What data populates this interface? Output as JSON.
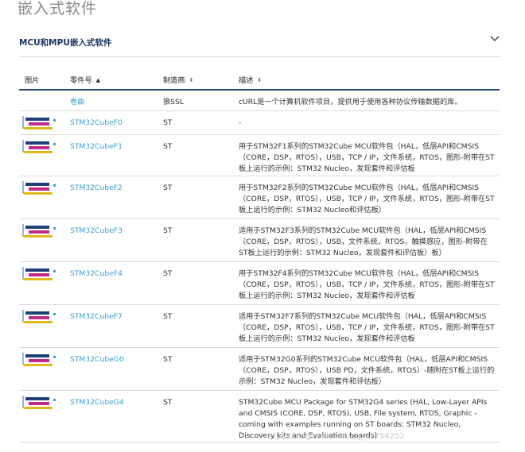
{
  "page": {
    "title": "嵌入式软件"
  },
  "section": {
    "title": "MCU和MPU嵌入式软件"
  },
  "table": {
    "headers": {
      "image": "图片",
      "part": "零件号",
      "manufacturer": "制造商",
      "description": "描述"
    },
    "rows": [
      {
        "has_image": false,
        "name": "卷曲",
        "manufacturer": "狼SSL",
        "description": "cURL是一个计算机软件项目，提供用于使用各种协议传输数据的库。"
      },
      {
        "has_image": true,
        "name": "STM32CubeF0",
        "manufacturer": "ST",
        "description": "-"
      },
      {
        "has_image": true,
        "name": "STM32CubeF1",
        "manufacturer": "ST",
        "description": "用于STM32F1系列的STM32Cube MCU软件包（HAL，低层API和CMSIS（CORE，DSP，RTOS），USB，TCP / IP，文件系统，RTOS，图形-附带在ST板上运行的示例：STM32 Nucleo，发现套件和评估板"
      },
      {
        "has_image": true,
        "name": "STM32CubeF2",
        "manufacturer": "ST",
        "description": "用于STM32F2系列的STM32Cube MCU软件包（HAL，低层API和CMSIS（CORE，DSP，RTOS），USB，TCP / IP，文件系统，RTOS，图形-附带在ST板上运行的示例：STM32 Nucleo和评估板）"
      },
      {
        "has_image": true,
        "name": "STM32CubeF3",
        "manufacturer": "ST",
        "description": "适用于STM32F3系列的STM32Cube MCU软件包（HAL，低层API和CMSIS（CORE，DSP，RTOS），USB，文件系统，RTOS，触摸感应，图形-附带在ST板上运行的示例：STM32 Nucleo，发现套件和评估板）板）"
      },
      {
        "has_image": true,
        "name": "STM32CubeF4",
        "manufacturer": "ST",
        "description": "用于STM32F4系列的STM32Cube MCU软件包（HAL，低层API和CMSIS（CORE，DSP，RTOS），USB，TCP / IP，文件系统，RTOS，图形-附带在ST板上运行的示例：STM32 Nucleo，发现套件和评估板"
      },
      {
        "has_image": true,
        "name": "STM32CubeF7",
        "manufacturer": "ST",
        "description": "适用于STM32F7系列的STM32Cube MCU软件包（HAL，低层API和CMSIS（CORE，DSP，RTOS），USB，TCP / IP，文件系统，RTOS，图形-附带在ST板上运行的示例：STM32 Nucleo，发现套件和评估板"
      },
      {
        "has_image": true,
        "name": "STM32CubeG0",
        "manufacturer": "ST",
        "description": "适用于STM32G0系列的STM32Cube MCU软件包（HAL，低层API和CMSIS（CORE，DSP，RTOS），USB PD，文件系统，RTOS）-随附在ST板上运行的示例：STM32 Nucleo，发现套件和评估板）"
      },
      {
        "has_image": true,
        "name": "STM32CubeG4",
        "manufacturer": "ST",
        "description": "STM32Cube MCU Package for STM32G4 series (HAL, Low-Layer APIs and CMSIS (CORE, DSP, RTOS), USB, File system, RTOS, Graphic - coming with examples running on ST boards: STM32 Nucleo, Discovery kits and Evaluation boards)"
      }
    ]
  },
  "watermark": "https://blog.csdn.net/qq_41754252"
}
